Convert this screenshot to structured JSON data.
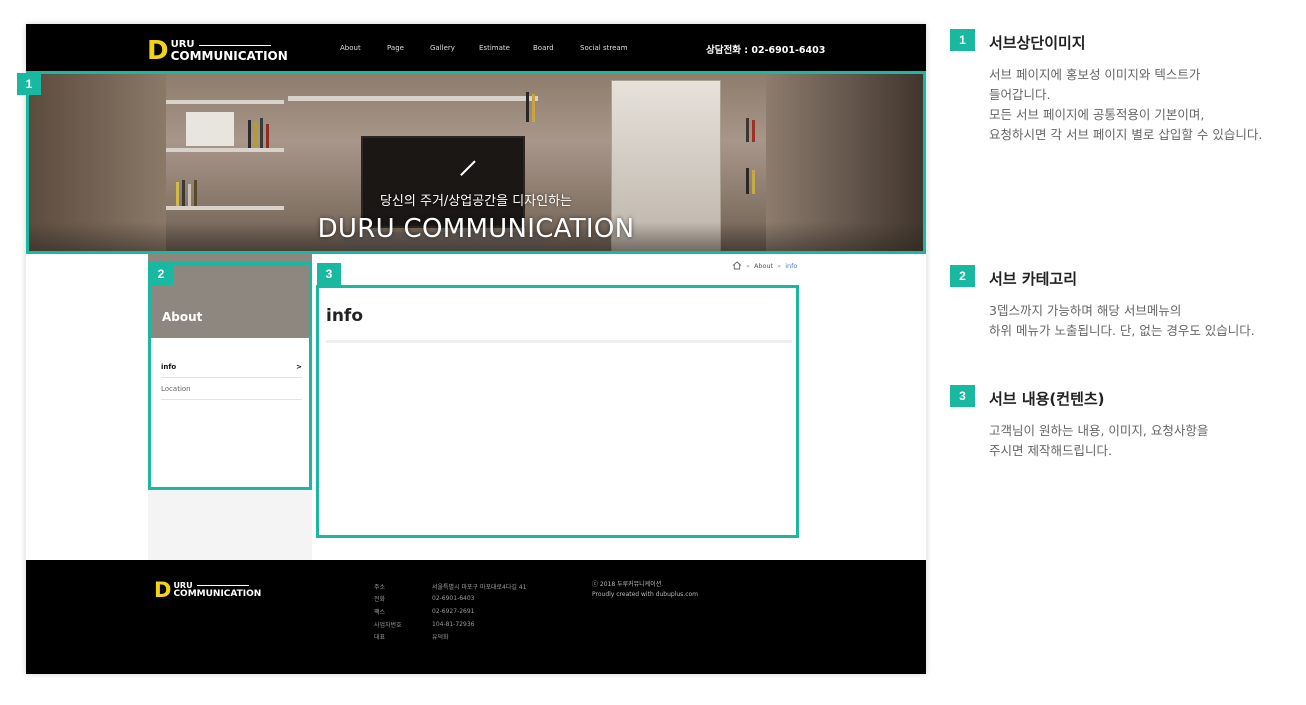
{
  "site": {
    "logo": {
      "initial": "D",
      "line1": "URU",
      "line2": "COMMUNICATION"
    },
    "nav": [
      "About",
      "Page",
      "Gallery",
      "Estimate",
      "Board",
      "Social stream"
    ],
    "phone": "상담전화 : 02-6901-6403"
  },
  "hero": {
    "subtitle": "당신의 주거/상업공간을 디자인하는",
    "title": "DURU COMMUNICATION"
  },
  "sidebar": {
    "category_title": "About",
    "items": [
      {
        "label": "info",
        "arrow": ">"
      },
      {
        "label": "Location"
      }
    ]
  },
  "breadcrumb": {
    "items": [
      "About",
      "info"
    ],
    "separator": "»"
  },
  "content": {
    "heading": "info"
  },
  "footer": {
    "info": [
      {
        "key": "주소",
        "value": "서울특별시 마포구 마포대로4다길 41"
      },
      {
        "key": "전화",
        "value": "02-6901-6403"
      },
      {
        "key": "팩스",
        "value": "02-6927-2691"
      },
      {
        "key": "사업자번호",
        "value": "104-81-72936"
      },
      {
        "key": "대표",
        "value": "유덕화"
      }
    ],
    "copyright": "ⓒ 2018 두루커뮤니케이션.",
    "credit": "Proudly created with dubuplus.com"
  },
  "annotations": {
    "badges": [
      "1",
      "2",
      "3"
    ],
    "items": [
      {
        "num": "1",
        "title": "서브상단이미지",
        "lines": [
          "서브 페이지에 홍보성 이미지와 텍스트가",
          "들어갑니다.",
          "모든 서브 페이지에 공통적용이 기본이며,",
          "요청하시면 각 서브 페이지 별로 삽입할 수 있습니다."
        ]
      },
      {
        "num": "2",
        "title": "서브 카테고리",
        "lines": [
          "3뎁스까지 가능하며 해당 서브메뉴의",
          "하위 메뉴가 노출됩니다. 단, 없는 경우도 있습니다."
        ]
      },
      {
        "num": "3",
        "title": "서브 내용(컨텐츠)",
        "lines": [
          "고객님이 원하는 내용, 이미지, 요청사항을",
          "주시면 제작해드립니다."
        ]
      }
    ]
  },
  "colors": {
    "accent": "#18b9a0",
    "logo_yellow": "#f3d21a",
    "sidebar_header": "#8e8780",
    "breadcrumb_current": "#3a7bd5"
  }
}
